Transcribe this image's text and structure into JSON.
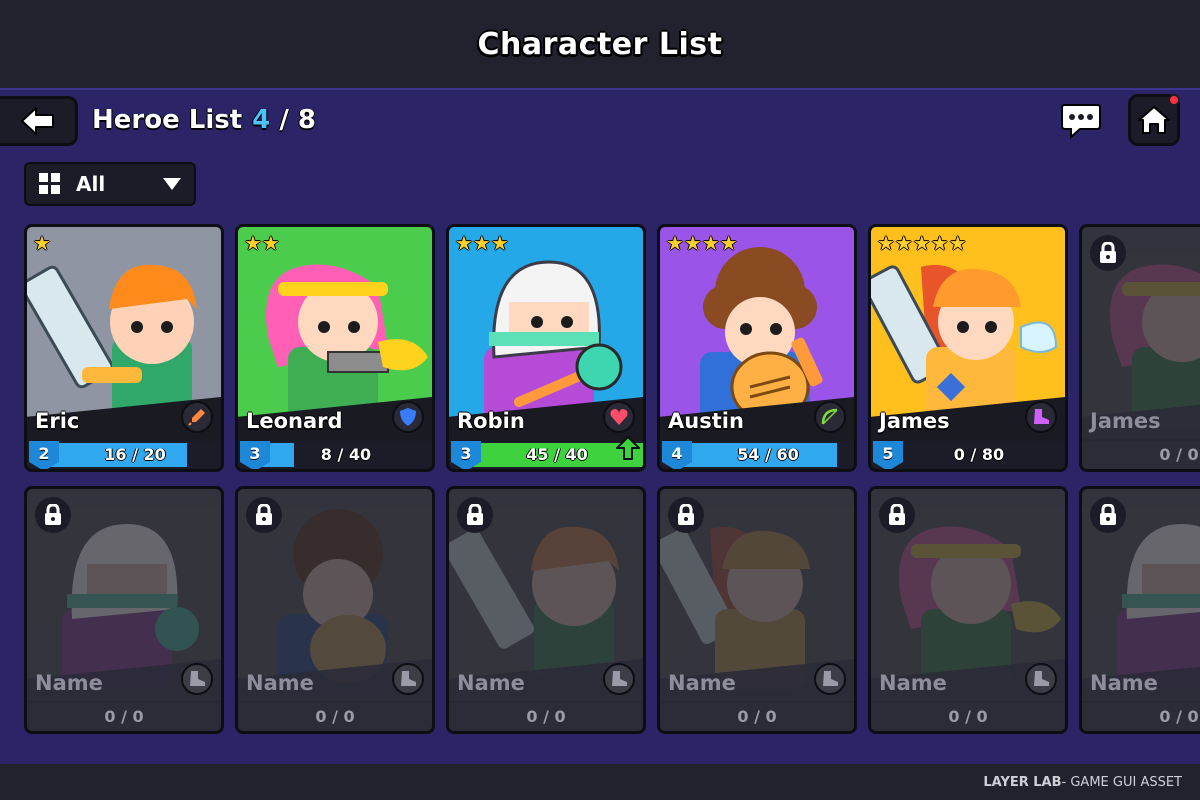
{
  "header": {
    "title": "Character List"
  },
  "toolbar": {
    "list_title": "Heroe List",
    "count_current": "4",
    "count_separator": "/",
    "count_max": "8",
    "back_icon": "arrow-left-icon",
    "chat_icon": "chat-bubble-icon",
    "home_icon": "home-icon",
    "home_has_notification": true
  },
  "filter": {
    "label": "All",
    "icon": "grid-icon",
    "dropdown_icon": "caret-down-icon"
  },
  "colors": {
    "background": "#2b2466",
    "topbar": "#22222e",
    "accent_blue": "#4cc3ff",
    "xp_blue": "#2fa8f0",
    "xp_green": "#3fd23f",
    "star": "#ffd02a",
    "notification": "#ff3344"
  },
  "heroes": [
    {
      "name": "Eric",
      "stars": "★",
      "level": "2",
      "xp": "16 / 20",
      "progress": 0.8,
      "bg": "#8f95a3",
      "class_icon": "rocket-icon",
      "class_color": "#ff8a3c",
      "upgrade_ready": false
    },
    {
      "name": "Leonard",
      "stars": "★★",
      "level": "3",
      "xp": "8 / 40",
      "progress": 0.2,
      "bg": "#4ccc4c",
      "class_icon": "shield-icon",
      "class_color": "#3a7cff",
      "upgrade_ready": false
    },
    {
      "name": "Robin",
      "stars": "★★★",
      "level": "3",
      "xp": "45 / 40",
      "progress": 1.0,
      "bg": "#24a8e8",
      "class_icon": "heart-icon",
      "class_color": "#ff4d6a",
      "upgrade_ready": true
    },
    {
      "name": "Austin",
      "stars": "★★★★",
      "level": "4",
      "xp": "54 / 60",
      "progress": 0.9,
      "bg": "#9b54e8",
      "class_icon": "bow-icon",
      "class_color": "#7ddb3a",
      "upgrade_ready": false
    },
    {
      "name": "James",
      "stars": "★★★★★",
      "level": "5",
      "xp": "0 / 80",
      "progress": 0.0,
      "bg": "#ffc01e",
      "class_icon": "boot-icon",
      "class_color": "#d060ff",
      "upgrade_ready": false
    }
  ],
  "locked_top": {
    "name": "James",
    "xp": "0 / 0"
  },
  "locked_bottom": [
    {
      "name": "Name",
      "xp": "0 / 0"
    },
    {
      "name": "Name",
      "xp": "0 / 0"
    },
    {
      "name": "Name",
      "xp": "0 / 0"
    },
    {
      "name": "Name",
      "xp": "0 / 0"
    },
    {
      "name": "Name",
      "xp": "0 / 0"
    },
    {
      "name": "Name",
      "xp": "0 / 0"
    }
  ],
  "footer": {
    "brand": "LAYER LAB",
    "text": " - GAME GUI ASSET"
  }
}
